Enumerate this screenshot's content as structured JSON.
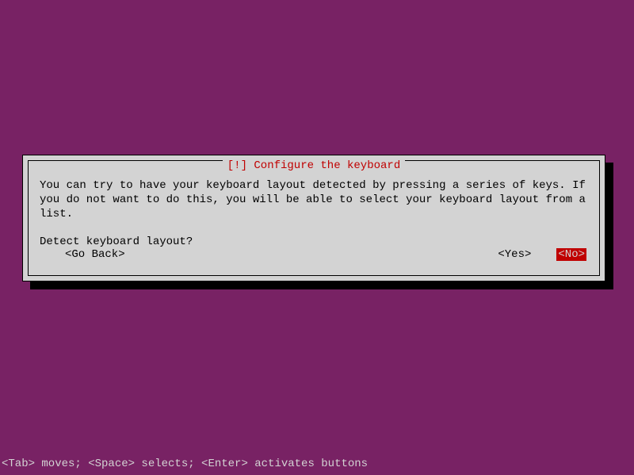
{
  "dialog": {
    "title": "[!] Configure the keyboard",
    "body": "You can try to have your keyboard layout detected by pressing a series of keys. If you do not want to do this, you will be able to select your keyboard layout from a list.",
    "question": "Detect keyboard layout?",
    "buttons": {
      "go_back": "<Go Back>",
      "yes": "<Yes>",
      "no": "<No>"
    }
  },
  "hint": "<Tab> moves; <Space> selects; <Enter> activates buttons"
}
